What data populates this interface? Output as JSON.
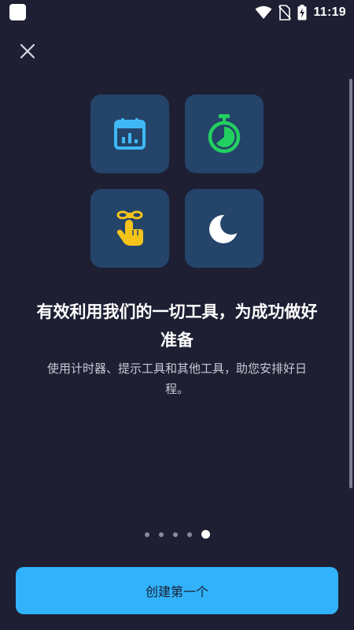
{
  "status_bar": {
    "time": "11:19"
  },
  "onboarding": {
    "close_label": "×",
    "headline": "有效利用我们的一切工具，为成功做好准备",
    "description": "使用计时器、提示工具和其他工具，助您安排好日程。",
    "tiles": [
      {
        "icon": "calendar-chart-icon",
        "color": "#3fb8f5"
      },
      {
        "icon": "stopwatch-icon",
        "color": "#22d05f"
      },
      {
        "icon": "finger-reminder-icon",
        "color": "#f4c41a"
      },
      {
        "icon": "crescent-moon-icon",
        "color": "#ffffff"
      }
    ],
    "pager": {
      "total": 5,
      "active_index": 4
    },
    "cta_label": "创建第一个"
  },
  "colors": {
    "background": "#1e1f33",
    "tile": "#24446a",
    "accent": "#31b2fb"
  }
}
